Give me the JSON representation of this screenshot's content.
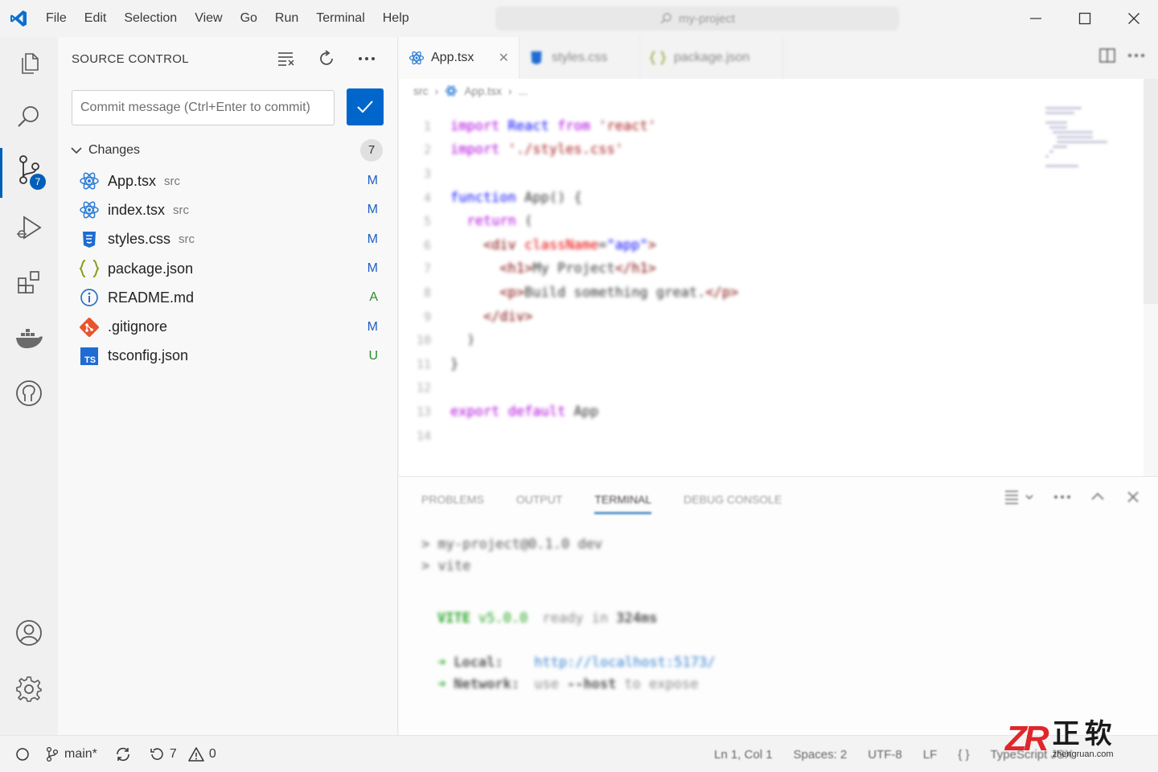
{
  "titlebar": {
    "menu": [
      "File",
      "Edit",
      "Selection",
      "View",
      "Go",
      "Run",
      "Terminal",
      "Help"
    ],
    "search_text": "my-project"
  },
  "activity_bar": {
    "items": [
      "explorer",
      "search",
      "source-control",
      "run-and-debug",
      "extensions",
      "docker",
      "remote"
    ],
    "source_control_badge": "7",
    "bottom": [
      "accounts",
      "manage"
    ]
  },
  "sidebar": {
    "title": "SOURCE CONTROL",
    "commit_placeholder": "Commit message (Ctrl+Enter to commit)",
    "changes_label": "Changes",
    "changes_count": "7",
    "files": [
      {
        "name": "App.tsx",
        "dir": "src",
        "status": "M",
        "icon": "react-icon"
      },
      {
        "name": "index.tsx",
        "dir": "src",
        "status": "M",
        "icon": "react-icon"
      },
      {
        "name": "styles.css",
        "dir": "src",
        "status": "M",
        "icon": "css-icon"
      },
      {
        "name": "package.json",
        "dir": "",
        "status": "M",
        "icon": "json-icon"
      },
      {
        "name": "README.md",
        "dir": "",
        "status": "A",
        "icon": "info-icon"
      },
      {
        "name": ".gitignore",
        "dir": "",
        "status": "M",
        "icon": "git-icon"
      },
      {
        "name": "tsconfig.json",
        "dir": "",
        "status": "U",
        "icon": "typescript-icon"
      }
    ]
  },
  "editor": {
    "tabs": [
      {
        "label": "App.tsx",
        "active": true
      },
      {
        "label": "styles.css",
        "active": false
      },
      {
        "label": "package.json",
        "active": false
      }
    ],
    "breadcrumb": [
      "src",
      "App.tsx",
      "..."
    ],
    "code": [
      {
        "n": "1",
        "parts": [
          [
            "kw",
            "import "
          ],
          [
            "kw2",
            "React "
          ],
          [
            "kw",
            "from "
          ],
          [
            "str",
            "'react'"
          ]
        ]
      },
      {
        "n": "2",
        "parts": [
          [
            "kw",
            "import "
          ],
          [
            "str",
            "'./styles.css'"
          ]
        ]
      },
      {
        "n": "3",
        "parts": []
      },
      {
        "n": "4",
        "parts": [
          [
            "kw2",
            "function "
          ],
          [
            "plain",
            "App() {"
          ]
        ]
      },
      {
        "n": "5",
        "parts": [
          [
            "plain",
            "  "
          ],
          [
            "kw",
            "return "
          ],
          [
            "plain",
            "("
          ]
        ]
      },
      {
        "n": "6",
        "parts": [
          [
            "plain",
            "    "
          ],
          [
            "tag",
            "<div "
          ],
          [
            "attr",
            "className"
          ],
          [
            "plain",
            "="
          ],
          [
            "kw2",
            "\"app\""
          ],
          [
            "tag",
            ">"
          ]
        ]
      },
      {
        "n": "7",
        "parts": [
          [
            "plain",
            "      "
          ],
          [
            "tag",
            "<h1>"
          ],
          [
            "plain",
            "My Project"
          ],
          [
            "tag",
            "</h1>"
          ]
        ]
      },
      {
        "n": "8",
        "parts": [
          [
            "plain",
            "      "
          ],
          [
            "tag",
            "<p>"
          ],
          [
            "plain",
            "Build something great."
          ],
          [
            "tag",
            "</p>"
          ]
        ]
      },
      {
        "n": "9",
        "parts": [
          [
            "plain",
            "    "
          ],
          [
            "tag",
            "</div>"
          ]
        ]
      },
      {
        "n": "10",
        "parts": [
          [
            "plain",
            "  )"
          ]
        ]
      },
      {
        "n": "11",
        "parts": [
          [
            "plain",
            "}"
          ]
        ]
      },
      {
        "n": "12",
        "parts": []
      },
      {
        "n": "13",
        "parts": [
          [
            "kw",
            "export "
          ],
          [
            "kw",
            "default "
          ],
          [
            "plain",
            "App"
          ]
        ]
      },
      {
        "n": "14",
        "parts": []
      }
    ]
  },
  "panel": {
    "tabs": [
      {
        "label": "PROBLEMS",
        "active": false
      },
      {
        "label": "OUTPUT",
        "active": false
      },
      {
        "label": "TERMINAL",
        "active": true
      },
      {
        "label": "DEBUG CONSOLE",
        "active": false
      }
    ],
    "terminal": {
      "line1": "> my-project@0.1.0 dev",
      "line2": "> vite",
      "vite_name": "VITE",
      "vite_version": "v5.0.0",
      "vite_ready": "ready in",
      "vite_time": "324ms",
      "local_label": "Local:",
      "local_url": "http://localhost:5173/",
      "network_label": "Network:",
      "network_use": "use",
      "network_flag": "--host",
      "network_rest": "to expose"
    }
  },
  "statusbar": {
    "branch": "main*",
    "changes": "7",
    "warnings": "0",
    "position": "Ln 1, Col 1",
    "spaces": "Spaces: 2",
    "encoding": "UTF-8",
    "eol": "LF",
    "language": "TypeScript JSX"
  },
  "watermark": {
    "logo": "ZR",
    "cn": "正软",
    "url": "zhengruan.com"
  },
  "colors": {
    "accent": "#005fb8",
    "modified": "#1f5fbf",
    "added": "#2e8b2e",
    "untracked": "#2e8b2e"
  }
}
